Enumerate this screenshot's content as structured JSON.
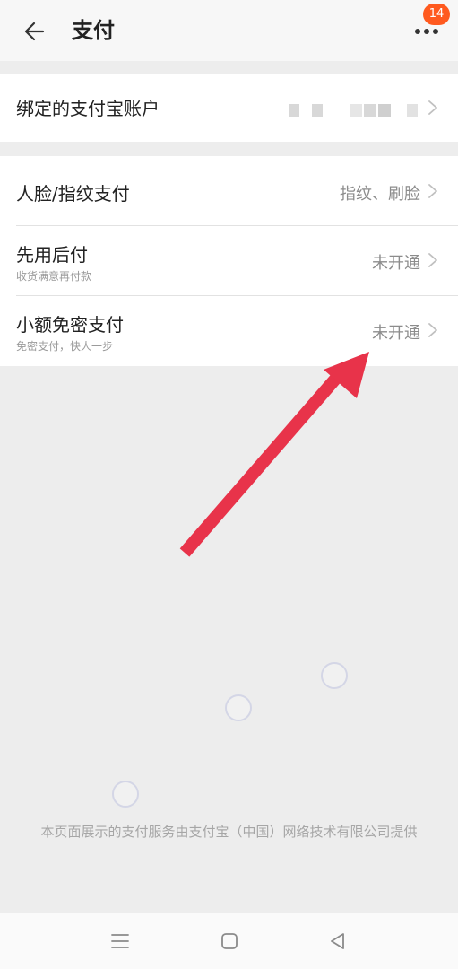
{
  "header": {
    "title": "支付",
    "badge_count": "14",
    "icons": {
      "back": "arrow-left-icon",
      "more": "more-dots-icon"
    }
  },
  "alipay_binding": {
    "label": "绑定的支付宝账户",
    "value_obscured": true
  },
  "payment_settings": [
    {
      "label": "人脸/指纹支付",
      "sub": "",
      "value": "指纹、刷脸"
    },
    {
      "label": "先用后付",
      "sub": "收货满意再付款",
      "value": "未开通"
    },
    {
      "label": "小额免密支付",
      "sub": "免密支付，快人一步",
      "value": "未开通"
    }
  ],
  "footer_note": "本页面展示的支付服务由支付宝（中国）网络技术有限公司提供",
  "navbar": {
    "icons": [
      "menu-icon",
      "home-square-icon",
      "back-triangle-icon"
    ]
  },
  "colors": {
    "annotation_arrow": "#e8334a",
    "badge": "#ff5a1f",
    "page_background": "#ededed"
  }
}
